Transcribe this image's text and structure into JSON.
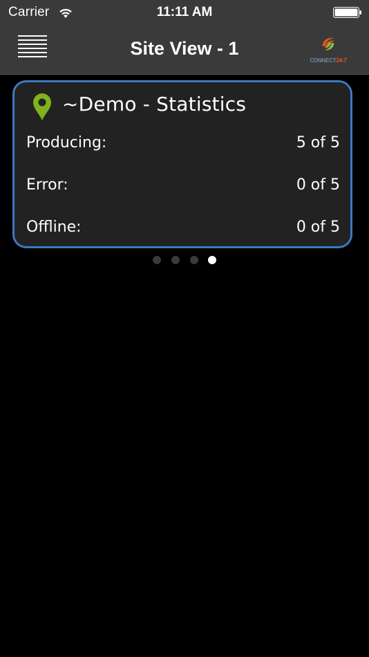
{
  "status_bar": {
    "carrier": "Carrier",
    "time": "11:11 AM"
  },
  "nav": {
    "title": "Site View - 1",
    "logo": {
      "text_main": "CONNECT",
      "text_accent": "24-7"
    }
  },
  "card": {
    "title": "~Demo - Statistics",
    "stats": [
      {
        "label": "Producing:",
        "value": "5 of 5"
      },
      {
        "label": "Error:",
        "value": "0 of 5"
      },
      {
        "label": "Offline:",
        "value": "0 of 5"
      }
    ]
  },
  "page_indicator": {
    "count": 4,
    "active_index": 3
  },
  "colors": {
    "bar_background": "#3a3a3a",
    "card_border": "#3d79c0",
    "card_background": "#222222",
    "pin_green": "#7fb21e",
    "logo_orange": "#e0541d",
    "logo_green": "#8cc43c"
  },
  "icons": [
    "wifi-icon",
    "battery-icon",
    "menu-icon",
    "map-pin-icon",
    "logo-swirl-icon"
  ]
}
